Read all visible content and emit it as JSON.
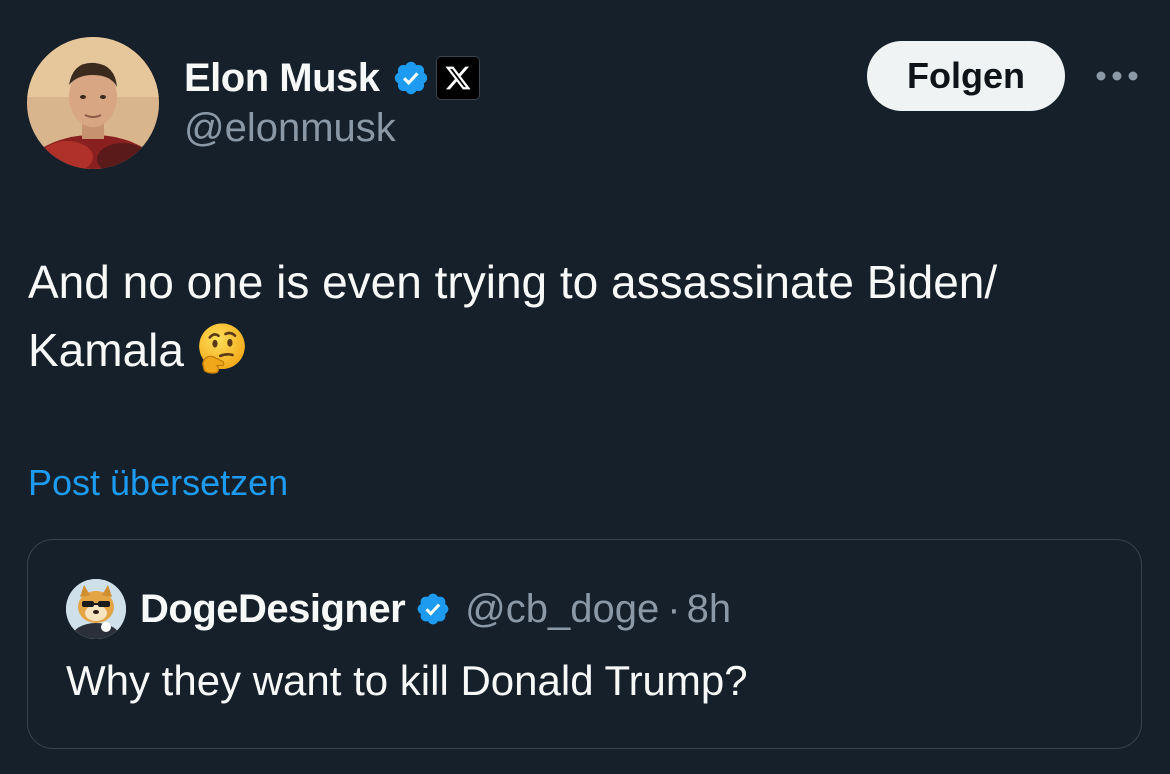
{
  "author": {
    "display_name": "Elon Musk",
    "handle": "@elonmusk",
    "verified": true,
    "affiliate_badge": "x-logo-icon"
  },
  "actions": {
    "follow_label": "Folgen",
    "more_icon": "more-options-icon"
  },
  "post": {
    "text": "And no one is even trying to assassinate Biden/ Kamala",
    "emoji": "thinking-face-emoji",
    "translate_label": "Post übersetzen"
  },
  "quoted_post": {
    "display_name": "DogeDesigner",
    "handle": "@cb_doge",
    "separator": "·",
    "time": "8h",
    "verified": true,
    "text": "Why they want to kill Donald Trump?"
  },
  "colors": {
    "background": "#15202b",
    "text_primary": "#f7f9f9",
    "text_secondary": "#8b98a5",
    "link": "#1d9bf0",
    "verified_blue": "#1d9bf0",
    "border": "#38444d",
    "follow_bg": "#eff3f4"
  }
}
